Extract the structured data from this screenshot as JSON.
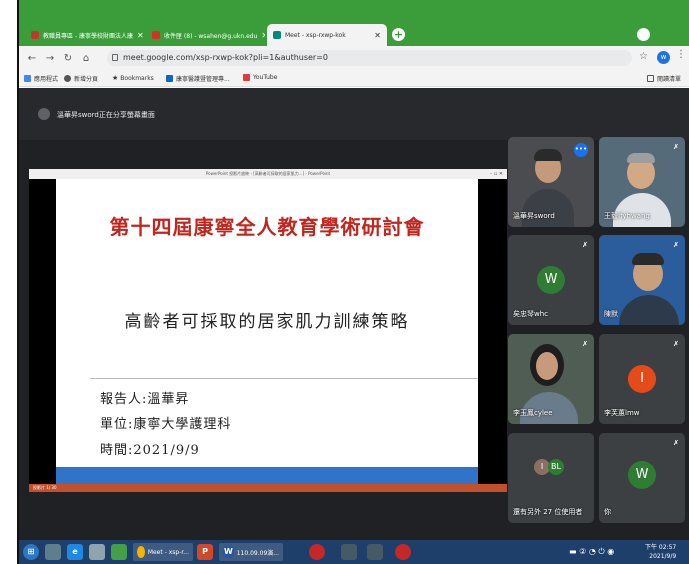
{
  "browser": {
    "tabs": [
      {
        "label": "教職員專區 - 康寧學校財團法人康",
        "color": "#c0392b"
      },
      {
        "label": "收件匣 (8) - wsahen@g.ukn.edu",
        "color": "#d93025"
      },
      {
        "label": "Meet - xsp-rxwp-kok",
        "color": "#00897b"
      }
    ],
    "new_tab": "+",
    "url": "meet.google.com/xsp-rxwp-kok?pli=1&authuser=0",
    "profile_initial": "w",
    "bookmarks": [
      {
        "label": "應用程式",
        "color": "#4285f4"
      },
      {
        "label": "新增分頁",
        "color": "#555555"
      },
      {
        "label": "Bookmarks",
        "color": "#333333"
      },
      {
        "label": "康寧醫護暨管理專...",
        "color": "#1565c0"
      },
      {
        "label": "YouTube",
        "color": "#e53935"
      }
    ],
    "reading_list": "閱讀清單"
  },
  "meet": {
    "banner": "溫華昇sword正在分享螢幕畫面",
    "presentation": {
      "window_title": "PowerPoint 投影片放映 - [高齡者可採取的居家肌力...] - PowerPoint",
      "slide": {
        "title": "第十四屆康寧全人教育學術研討會",
        "subtitle": "高齡者可採取的居家肌力訓練策略",
        "lines": [
          "報告人:溫華昇",
          "單位:康寧大學護理科",
          "時間:2021/9/9"
        ]
      },
      "status_text": "投影片 1/ 30"
    },
    "tiles": [
      {
        "name": "溫華昇sword",
        "kind": "video"
      },
      {
        "name": "王毅Ifyhwang",
        "kind": "video"
      },
      {
        "name": "矣忠琴whc",
        "kind": "avatar",
        "initial": "W",
        "color": "#2e7d32"
      },
      {
        "name": "陳默",
        "kind": "video"
      },
      {
        "name": "李玉鳳cylee",
        "kind": "video"
      },
      {
        "name": "李芙蕙lmw",
        "kind": "avatar",
        "initial": "I",
        "color": "#e64a19"
      },
      {
        "name": "還有另外 27 位使用者",
        "kind": "group",
        "initials": [
          "I",
          "BL"
        ]
      },
      {
        "name": "你",
        "kind": "avatar",
        "initial": "W",
        "color": "#2e7d32"
      }
    ]
  },
  "taskbar": {
    "tasks": [
      {
        "label": "Meet - xsp-r..."
      },
      {
        "label": "110.09.09演..."
      }
    ],
    "clock_period": "下午 02:57",
    "clock_date": "2021/9/9"
  }
}
